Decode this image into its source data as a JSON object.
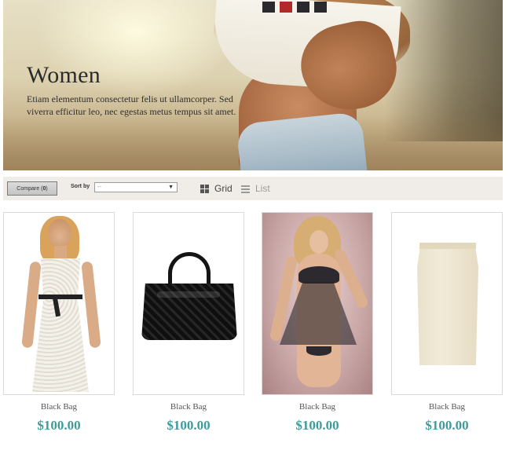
{
  "banner": {
    "title": "Women",
    "text": "Etiam elementum consectetur felis ut ullamcorper. Sed viverra efficitur leo, nec egestas metus tempus sit amet."
  },
  "toolbar": {
    "compare_label": "Compare",
    "compare_count": "0",
    "sort_label": "Sort by",
    "sort_value": "--",
    "view_grid": "Grid",
    "view_list": "List",
    "active_view": "Grid"
  },
  "products": [
    {
      "name": "Black Bag",
      "price": "$100.00",
      "image": "white-lace-dress"
    },
    {
      "name": "Black Bag",
      "price": "$100.00",
      "image": "black-handbag"
    },
    {
      "name": "Black Bag",
      "price": "$100.00",
      "image": "black-lingerie"
    },
    {
      "name": "Black Bag",
      "price": "$100.00",
      "image": "cream-pencil-skirt"
    }
  ],
  "colors": {
    "price": "#3f9a9a",
    "toolbar_bg": "#f0ede8"
  }
}
